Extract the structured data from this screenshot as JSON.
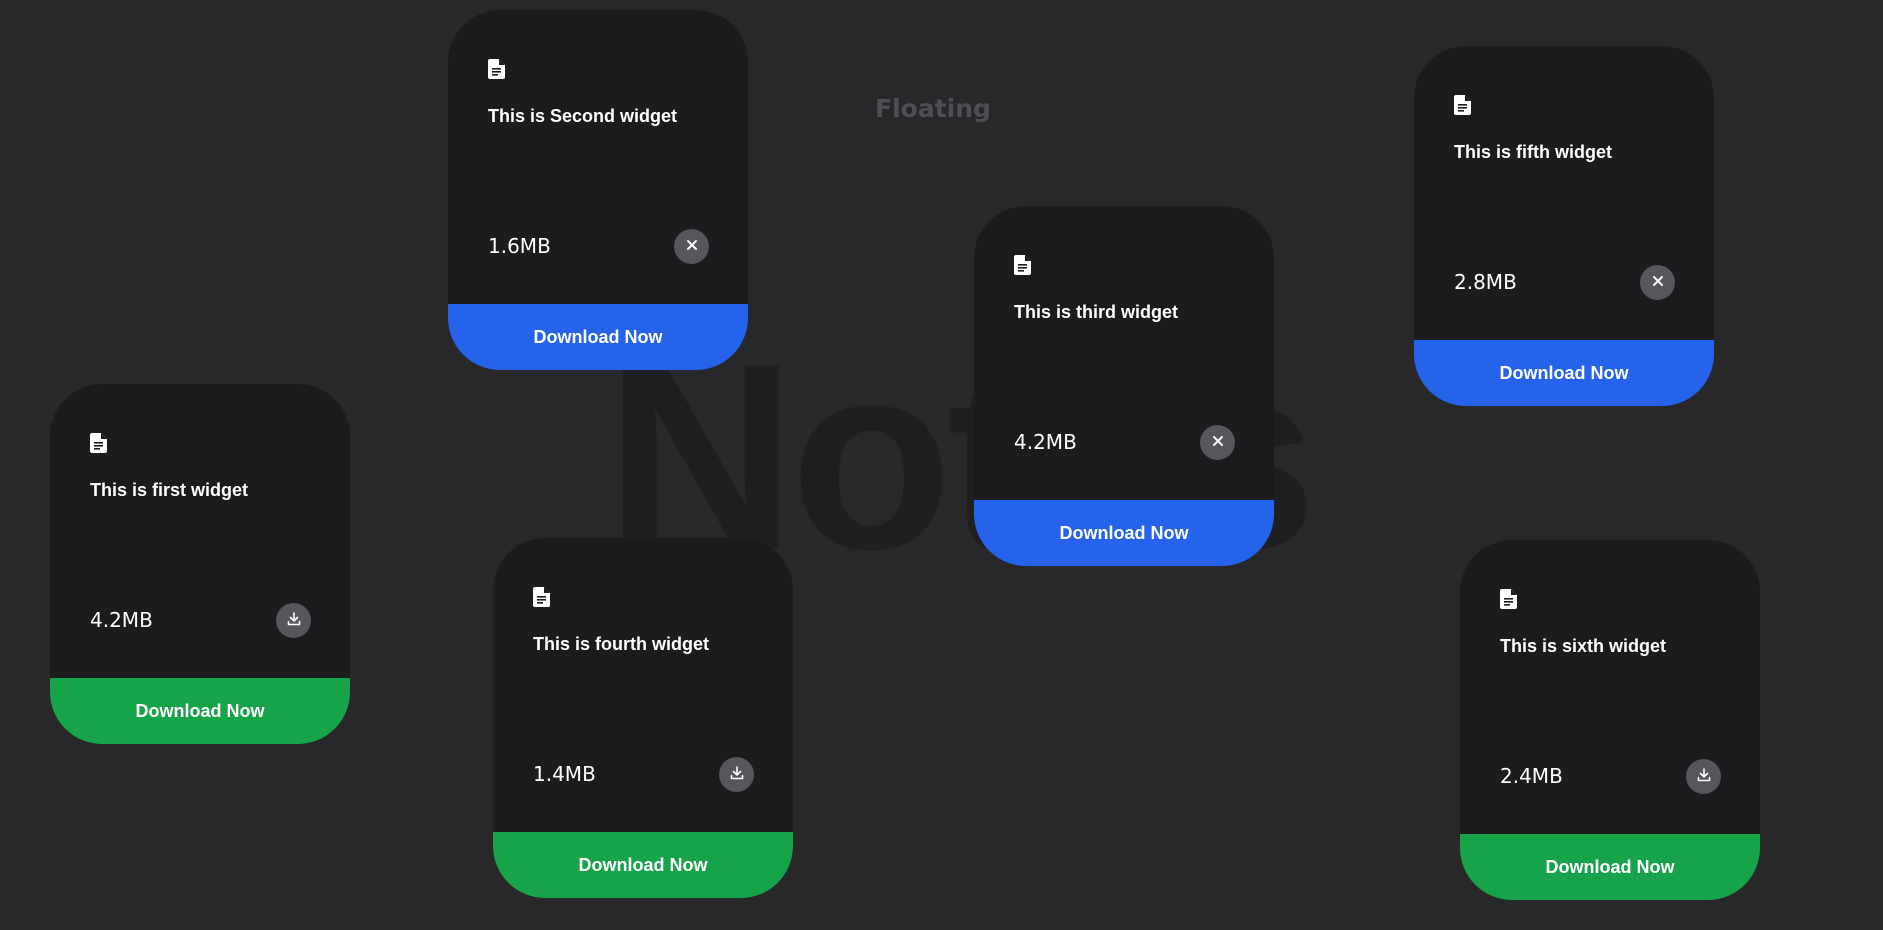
{
  "header": {
    "floating_label": "Floating",
    "background_title": "Notes"
  },
  "colors": {
    "background": "#28282b",
    "card": "#1c1c1e",
    "download_green": "#16a34a",
    "download_blue": "#2563eb",
    "action_button": "#56565b"
  },
  "widgets": [
    {
      "title": "This is first widget",
      "size": "4.2MB",
      "action_icon": "download-icon",
      "button_label": "Download Now",
      "button_color": "green"
    },
    {
      "title": "This is Second widget",
      "size": "1.6MB",
      "action_icon": "close-icon",
      "button_label": "Download Now",
      "button_color": "blue"
    },
    {
      "title": "This is third widget",
      "size": "4.2MB",
      "action_icon": "close-icon",
      "button_label": "Download Now",
      "button_color": "blue"
    },
    {
      "title": "This is fourth widget",
      "size": "1.4MB",
      "action_icon": "download-icon",
      "button_label": "Download Now",
      "button_color": "green"
    },
    {
      "title": "This is fifth widget",
      "size": "2.8MB",
      "action_icon": "close-icon",
      "button_label": "Download Now",
      "button_color": "blue"
    },
    {
      "title": "This is sixth widget",
      "size": "2.4MB",
      "action_icon": "download-icon",
      "button_label": "Download Now",
      "button_color": "green"
    }
  ]
}
